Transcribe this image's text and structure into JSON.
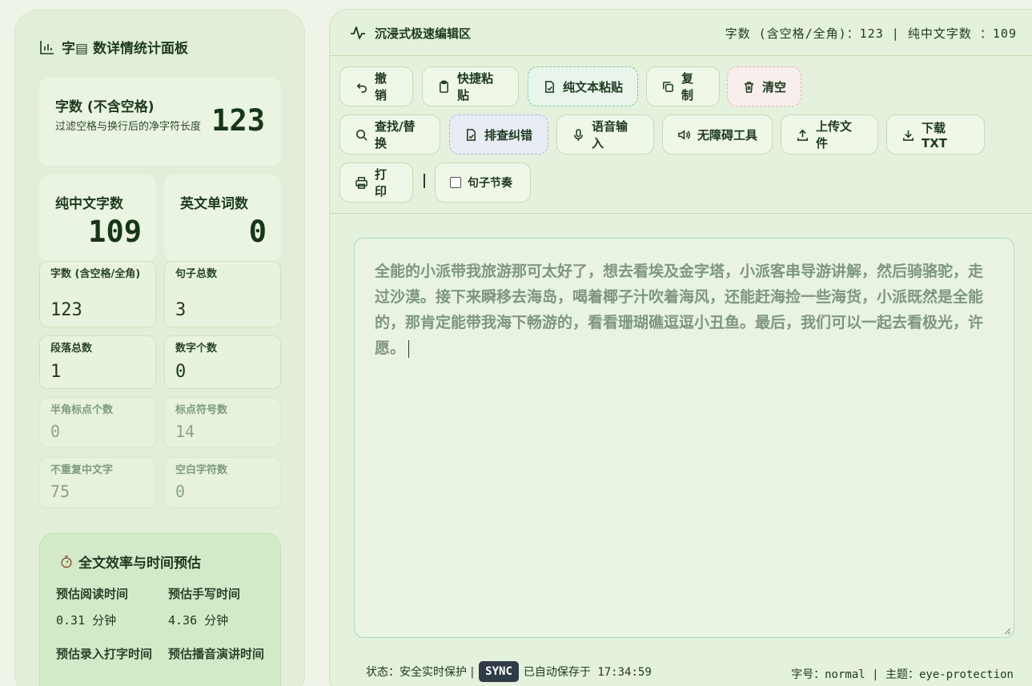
{
  "sidebar": {
    "title": "字▤ 数详情统计面板",
    "main_card": {
      "label": "字数 (不含空格)",
      "sub": "过滤空格与换行后的净字符长度",
      "value": "123"
    },
    "chinese_card": {
      "label": "纯中文字数",
      "value": "109"
    },
    "english_card": {
      "label": "英文单词数",
      "value": "0"
    },
    "stats": [
      {
        "label": "字数 (含空格/全角)",
        "value": "123"
      },
      {
        "label": "句子总数",
        "value": "3"
      },
      {
        "label": "段落总数",
        "value": "1"
      },
      {
        "label": "数字个数",
        "value": "0"
      },
      {
        "label": "半角标点个数",
        "value": "0"
      },
      {
        "label": "标点符号数",
        "value": "14"
      },
      {
        "label": "不重复中文字",
        "value": "75"
      },
      {
        "label": "空白字符数",
        "value": "0"
      }
    ],
    "efficiency": {
      "title": "全文效率与时间预估",
      "read_label": "预估阅读时间",
      "read_value": "0.31 分钟",
      "write_label": "预估手写时间",
      "write_value": "4.36 分钟",
      "type_label": "预估录入打字时间",
      "speech_label": "预估播音演讲时间"
    }
  },
  "topbar": {
    "title": "沉浸式极速编辑区",
    "counts": "字数 (含空格/全角)：123  |  纯中文字数 ：109"
  },
  "toolbar": {
    "undo": "撤销",
    "paste": "快捷粘贴",
    "plain_paste": "纯文本粘贴",
    "copy": "复制",
    "clear": "清空",
    "find": "查找/替换",
    "proofread": "排查纠错",
    "voice": "语音输入",
    "accessibility": "无障碍工具",
    "upload": "上传文件",
    "download": "下载TXT",
    "print": "打印",
    "rhythm": "句子节奏"
  },
  "editor": {
    "content": "全能的小派带我旅游那可太好了，想去看埃及金字塔，小派客串导游讲解，然后骑骆驼，走过沙漠。接下来瞬移去海岛，喝着椰子汁吹着海风，还能赶海捡一些海货，小派既然是全能的，那肯定能带我海下畅游的，看看珊瑚礁逗逗小丑鱼。最后，我们可以一起去看极光，许愿。"
  },
  "status": {
    "state": "状态：安全实时保护 |",
    "sync": "SYNC",
    "saved": "已自动保存于 17:34:59",
    "right": "字号：normal | 主题：eye-protection"
  }
}
